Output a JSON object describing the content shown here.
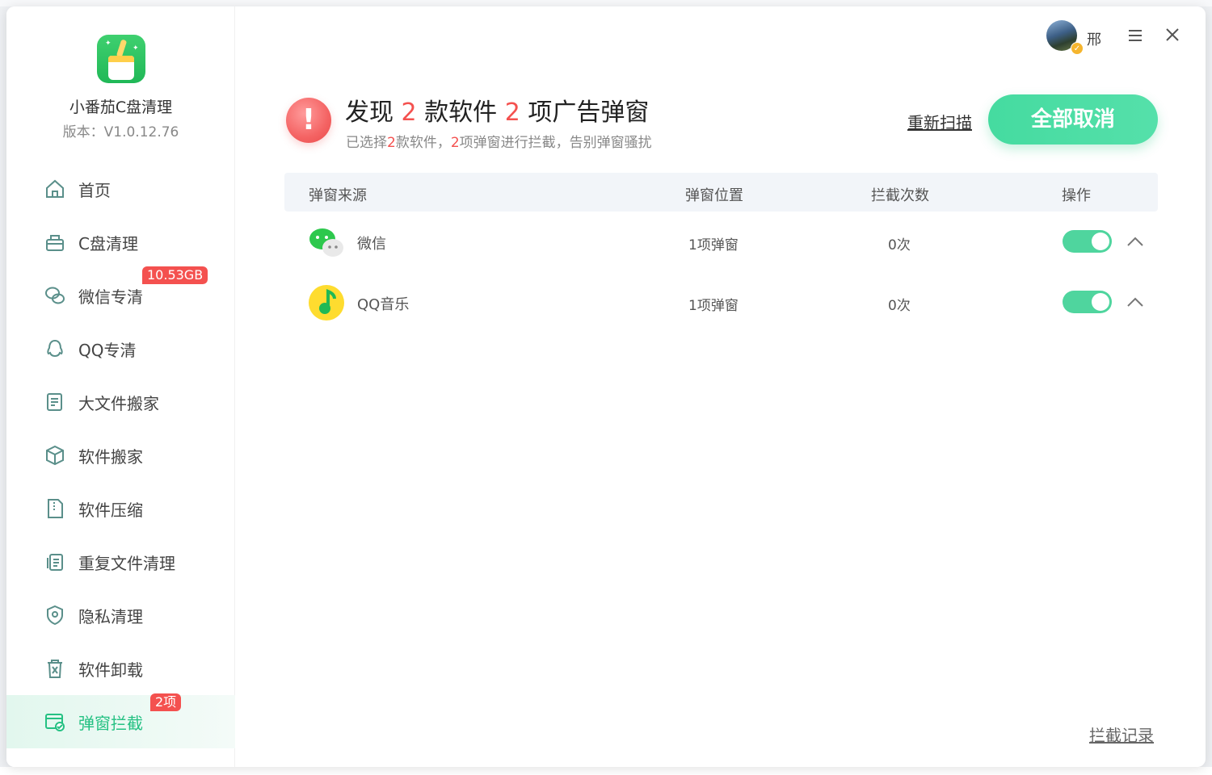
{
  "app": {
    "name": "小番茄C盘清理",
    "version": "版本：V1.0.12.76"
  },
  "nav": [
    {
      "label": "首页",
      "icon": "home-icon"
    },
    {
      "label": "C盘清理",
      "icon": "basket-icon"
    },
    {
      "label": "微信专清",
      "icon": "wechat-icon",
      "badge": "10.53GB"
    },
    {
      "label": "QQ专清",
      "icon": "qq-icon"
    },
    {
      "label": "大文件搬家",
      "icon": "file-move-icon"
    },
    {
      "label": "软件搬家",
      "icon": "box-icon"
    },
    {
      "label": "软件压缩",
      "icon": "zip-icon"
    },
    {
      "label": "重复文件清理",
      "icon": "duplicate-icon"
    },
    {
      "label": "隐私清理",
      "icon": "shield-icon"
    },
    {
      "label": "软件卸载",
      "icon": "trash-icon"
    },
    {
      "label": "弹窗拦截",
      "icon": "popup-block-icon",
      "badge": "2项",
      "active": true
    }
  ],
  "header": {
    "user_name": "邢"
  },
  "summary": {
    "title_prefix": "发现",
    "software_count": "2",
    "title_mid": "款软件",
    "popup_count": "2",
    "title_suffix": "项广告弹窗",
    "sub_a": "已选择",
    "sub_count1": "2",
    "sub_b": "款软件，",
    "sub_count2": "2",
    "sub_c": "项弹窗进行拦截，告别弹窗骚扰",
    "rescan_label": "重新扫描",
    "cancel_all_label": "全部取消"
  },
  "table": {
    "headers": [
      "弹窗来源",
      "弹窗位置",
      "拦截次数",
      "操作"
    ],
    "rows": [
      {
        "app": "微信",
        "icon": "wechat-app-icon",
        "position": "1项弹窗",
        "count": "0次",
        "enabled": true
      },
      {
        "app": "QQ音乐",
        "icon": "qqmusic-app-icon",
        "position": "1项弹窗",
        "count": "0次",
        "enabled": true
      }
    ]
  },
  "footer": {
    "history_label": "拦截记录"
  },
  "colors": {
    "accent": "#25c183",
    "toggle_on": "#4fd59e",
    "highlight_red": "#f4514f"
  }
}
